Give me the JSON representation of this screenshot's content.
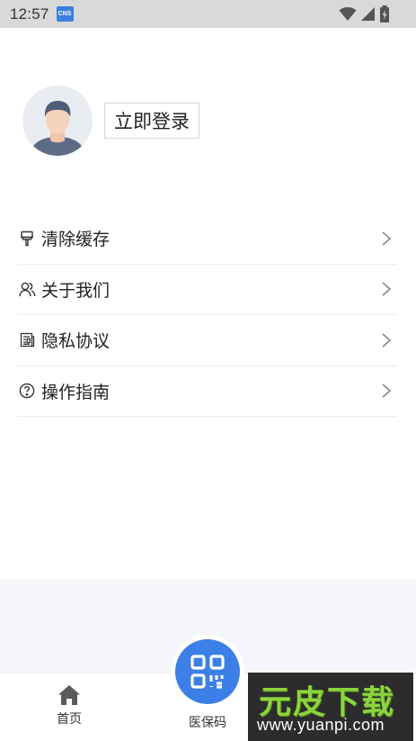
{
  "status_bar": {
    "time": "12:57",
    "app_badge": "CNS"
  },
  "profile": {
    "login_label": "立即登录"
  },
  "menu": {
    "items": [
      {
        "label": "清除缓存",
        "icon": "brush-icon"
      },
      {
        "label": "关于我们",
        "icon": "users-icon"
      },
      {
        "label": "隐私协议",
        "icon": "document-icon"
      },
      {
        "label": "操作指南",
        "icon": "help-circle-icon"
      }
    ]
  },
  "bottom_nav": {
    "home_label": "首页",
    "qr_label": "医保码"
  },
  "watermark": {
    "title": "元皮下载",
    "url": "www.yuanpi.com"
  },
  "colors": {
    "accent": "#3c7fe6",
    "status_bar": "#d9d9d9",
    "grey_area": "#f5f6fa"
  }
}
